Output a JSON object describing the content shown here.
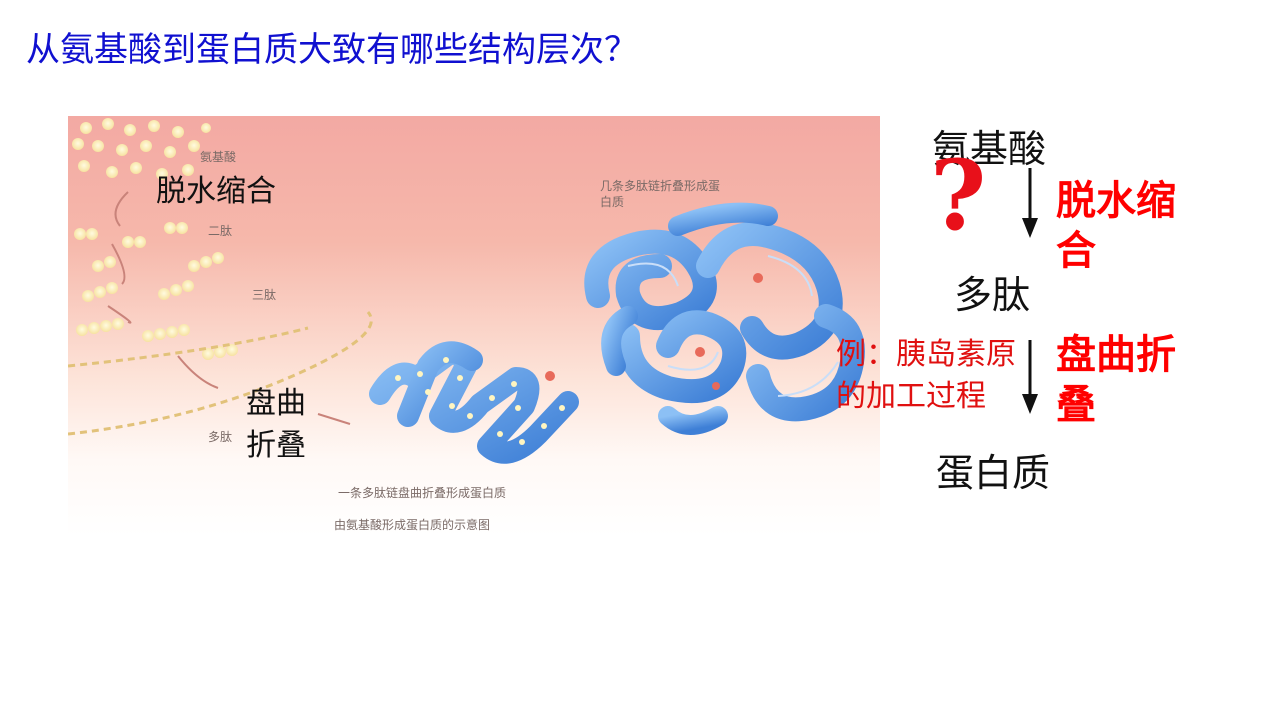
{
  "title": "从氨基酸到蛋白质大致有哪些结构层次？",
  "figure": {
    "small_labels": {
      "amino_acid": "氨基酸",
      "dipeptide": "二肽",
      "tripeptide": "三肽",
      "polypeptide": "多肽",
      "multi_chain": "几条多肽链折叠形成蛋白质",
      "caption_single": "一条多肽链盘曲折叠形成蛋白质",
      "caption_main": "由氨基酸形成蛋白质的示意图"
    },
    "overlay": {
      "dehydration": "脱水缩合",
      "folding_line1": "盘曲",
      "folding_line2": "折叠"
    }
  },
  "flow": {
    "amino_acid": "氨基酸",
    "question_mark": "?",
    "step1": "脱水缩合",
    "polypeptide": "多肽",
    "step2": "盘曲折叠",
    "protein": "蛋白质",
    "example": "例：胰岛素原的加工过程"
  },
  "colors": {
    "title": "#1010d0",
    "accent_red": "#ff0000",
    "protein_blue": "#4a8fe0"
  }
}
